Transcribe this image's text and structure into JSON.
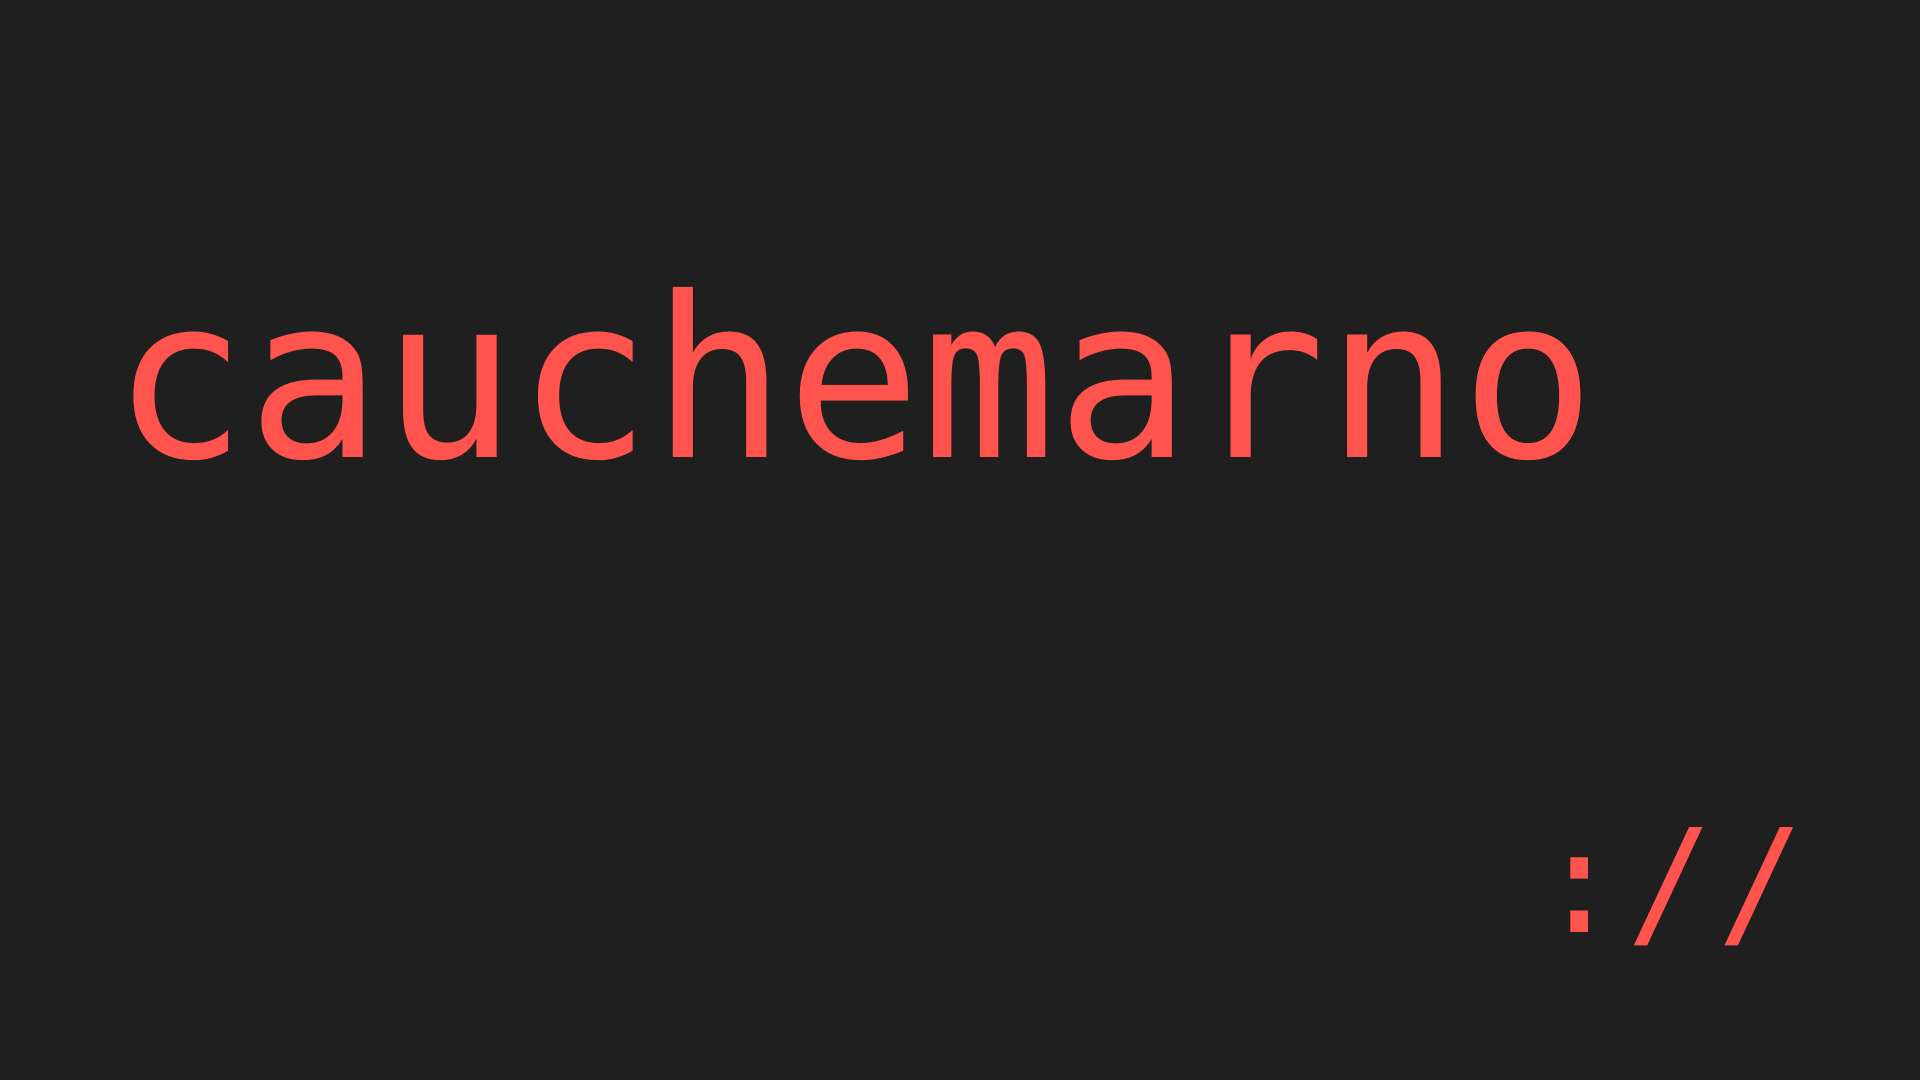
{
  "brand": {
    "name": "cauchemarno",
    "suffix": "://"
  },
  "colors": {
    "background": "#1f1f1f",
    "accent": "#ff544d"
  }
}
